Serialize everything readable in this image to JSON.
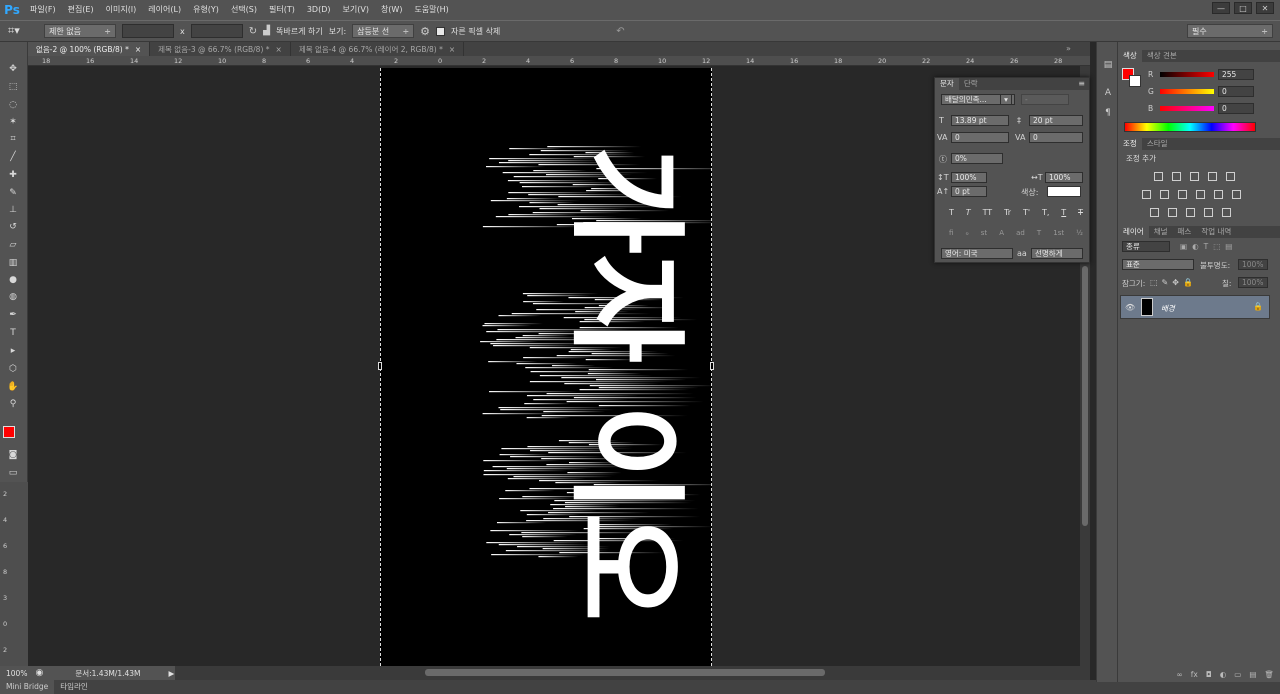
{
  "app": {
    "logo": "Ps"
  },
  "menu": [
    "파일(F)",
    "편집(E)",
    "이미지(I)",
    "레이어(L)",
    "유형(Y)",
    "선택(S)",
    "필터(T)",
    "3D(D)",
    "보기(V)",
    "창(W)",
    "도움말(H)"
  ],
  "window_controls": {
    "minimize": "—",
    "restore": "□",
    "close": "✕"
  },
  "options": {
    "ratio": "제한 없음",
    "x_sep": "x",
    "straighten": "똑바르게 하기",
    "view_label": "보기:",
    "view_value": "삼등분 선",
    "delete_cropped": "자른 픽셀 삭제",
    "workspace": "필수"
  },
  "tabs": [
    "없음-2 @ 100% (RGB/8) *",
    "제목 없음-3 @ 66.7% (RGB/8) *",
    "제목 없음-4 @ 66.7% (레이어 2, RGB/8) *"
  ],
  "ruler_h": [
    "18",
    "16",
    "14",
    "12",
    "10",
    "8",
    "6",
    "4",
    "2",
    "0",
    "2",
    "4",
    "6",
    "8",
    "10",
    "12",
    "14",
    "16",
    "18",
    "20",
    "22",
    "24",
    "26",
    "28",
    "30"
  ],
  "ruler_v": [
    "2",
    "4",
    "6",
    "8",
    "3",
    "0",
    "2"
  ],
  "canvas_text": "가자 이오",
  "status": {
    "zoom": "100%",
    "doc": "문서:1.43M/1.43M",
    "arrow": "▶"
  },
  "bottom_tabs": [
    "Mini Bridge",
    "타임라인"
  ],
  "color_panel": {
    "tabs": [
      "색상",
      "색상 견본"
    ],
    "r_label": "R",
    "g_label": "G",
    "b_label": "B",
    "r": "255",
    "g": "0",
    "b": "0",
    "fg": "#ff0000",
    "bg": "#ffffff"
  },
  "adjust_panel": {
    "tabs": [
      "조정",
      "스타일"
    ],
    "title": "조정 추가"
  },
  "layers_panel": {
    "tabs": [
      "레이어",
      "채널",
      "패스",
      "작업 내역"
    ],
    "filter": "종류",
    "blend": "표준",
    "opacity_label": "불투명도:",
    "opacity": "100%",
    "lock_label": "잠그기:",
    "fill_label": "칠:",
    "fill": "100%",
    "layer_name": "배경",
    "footer_icons": [
      "∞",
      "fx",
      "◘",
      "◐",
      "▭",
      "▤",
      "🗑"
    ]
  },
  "char_panel": {
    "tabs": [
      "문자",
      "단락"
    ],
    "font": "배달의민족...",
    "font_style": "-",
    "size": "13.89 pt",
    "leading": "20 pt",
    "kerning": "0",
    "tracking": "0",
    "tsume": "0%",
    "vscale": "100%",
    "hscale": "100%",
    "baseline": "0 pt",
    "color_label": "색상:",
    "style_buttons": [
      "T",
      "T",
      "TT",
      "Tr",
      "T'",
      "T,",
      "T",
      "T"
    ],
    "ot_buttons": [
      "fi",
      "ℴ",
      "st",
      "A",
      "ad",
      "T",
      "1st",
      "½"
    ],
    "language": "영어: 미국",
    "aa_icon": "aa",
    "aa": "선명하게"
  }
}
